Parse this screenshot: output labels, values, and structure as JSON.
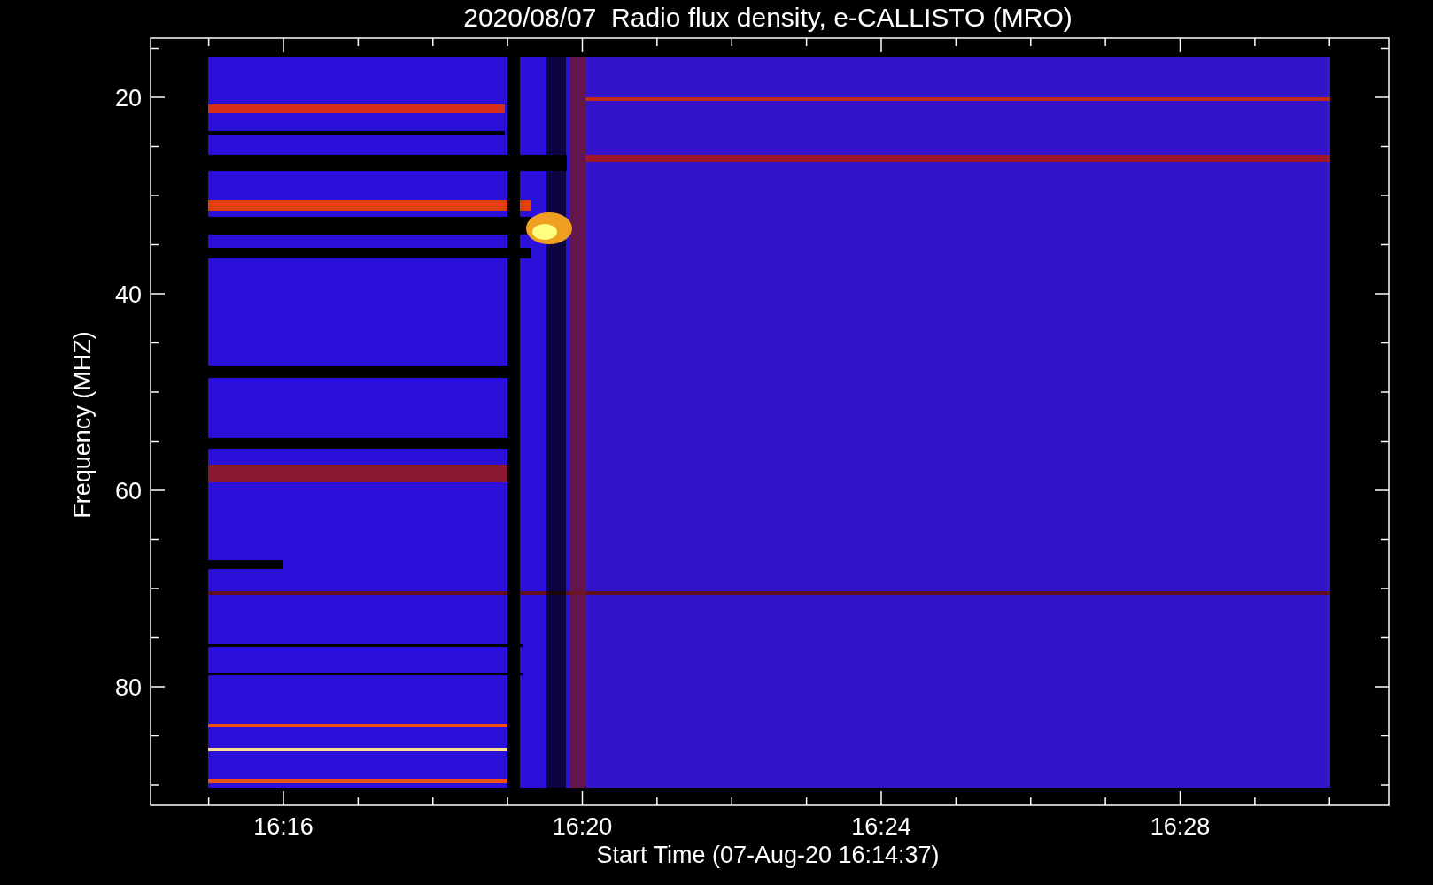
{
  "title": "2020/08/07  Radio flux density, e-CALLISTO (MRO)",
  "y_axis": {
    "label": "Frequency (MHZ)",
    "ticks": [
      "20",
      "40",
      "60",
      "80"
    ]
  },
  "x_axis": {
    "label": "Start Time (07-Aug-20 16:14:37)",
    "ticks": [
      "16:16",
      "16:20",
      "16:24",
      "16:28"
    ]
  }
}
